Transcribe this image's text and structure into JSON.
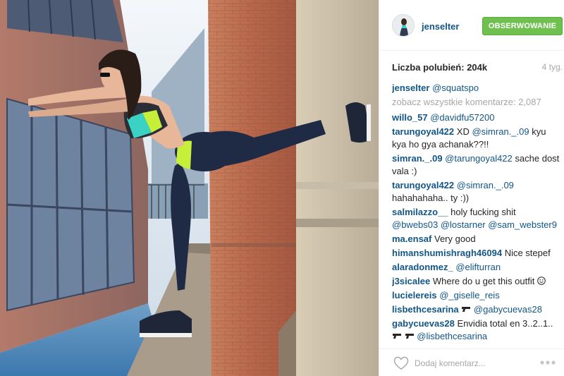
{
  "header": {
    "username": "jenselter",
    "follow_label": "OBSERWOWANIE"
  },
  "meta": {
    "likes_label": "Liczba polubień:",
    "likes_count": "204k",
    "time_ago": "4 tyg."
  },
  "caption": {
    "user": "jenselter",
    "mention": "@squatspo"
  },
  "view_all_label": "zobacz wszystkie komentarze: 2,087",
  "comments": [
    {
      "user": "willo_57",
      "mentions": "@davidfu57200",
      "text": ""
    },
    {
      "user": "tarungoyal422",
      "text_before": "XD",
      "mentions": "@simran._.09",
      "text": "kyu kya ho gya achanak??!!"
    },
    {
      "user": "simran._.09",
      "mentions": "@tarungoyal422",
      "text": "sache dost vala :)"
    },
    {
      "user": "tarungoyal422",
      "mentions": "@simran._.09",
      "text": "hahahahaha.. ty :))"
    },
    {
      "user": "salmilazzo__",
      "text_before": "holy fucking shit",
      "mentions": "@bwebs03 @lostarner @sam_webster9",
      "text": ""
    },
    {
      "user": "ma.ensaf",
      "text": "Very good"
    },
    {
      "user": "himanshumishragh46094",
      "text": "Nice stepef"
    },
    {
      "user": "alaradonmez_",
      "mentions": "@elifturran",
      "text": ""
    },
    {
      "user": "j3sicalee",
      "text": "Where do u get this outfit"
    },
    {
      "user": "lucielereis",
      "mentions": "@_giselle_reis",
      "text": ""
    },
    {
      "user": "lisbethcesarina",
      "mentions": "@gabycuevas28",
      "text": ""
    },
    {
      "user": "gabycuevas28",
      "text_before": "Envidia total en 3..2..1..",
      "mentions": "@lisbethcesarina",
      "text": ""
    }
  ],
  "footer": {
    "comment_placeholder": "Dodaj komentarz...",
    "like_icon": "heart-outline-icon",
    "more_icon": "more-dots-icon"
  },
  "colors": {
    "link_blue": "#125688",
    "follow_green": "#70c050",
    "muted_gray": "#a5a7aa",
    "text_dark": "#262626"
  }
}
